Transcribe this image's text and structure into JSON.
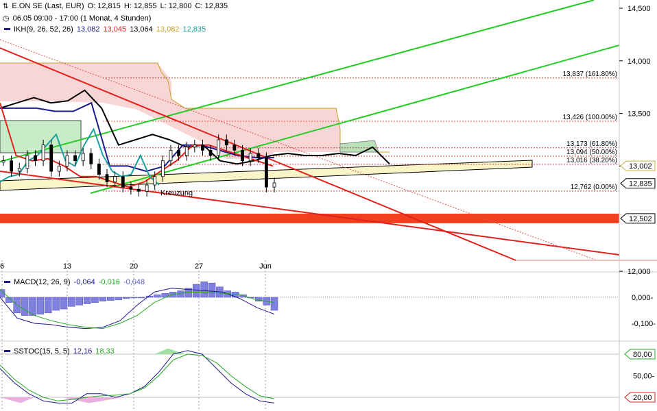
{
  "header": {
    "symbol": "E.ON SE (Last, EUR)",
    "ohlc": [
      "O: 12,815",
      "H: 12,855",
      "L: 12,800",
      "C: 12,835"
    ],
    "period": "06.05 09:00 - 17:00 (1 Monat, 4 Stunden)",
    "ikh_label": "IKH(9, 26, 52, 26)",
    "ikh_values": [
      {
        "text": "13,082",
        "color": "#1a1a8c"
      },
      {
        "text": "13,045",
        "color": "#e3211c"
      },
      {
        "text": "13,064",
        "color": "#000000"
      },
      {
        "text": "13,082",
        "color": "#c8a020"
      },
      {
        "text": "12,835",
        "color": "#1aa0a0"
      }
    ]
  },
  "chart_data": [
    {
      "type": "line",
      "panel": "price",
      "ylim": [
        12.0,
        14.5
      ],
      "y_ticks": [
        "14,500",
        "14,000",
        "13,500",
        "13,000",
        "12,000"
      ],
      "x_ticks": [
        "6",
        "13",
        "20",
        "27",
        "Jun"
      ],
      "series": [
        {
          "role": "close",
          "values": [
            13.05,
            12.95,
            12.98,
            13.1,
            13.05,
            13.2,
            12.95,
            13.0,
            13.1,
            13.05,
            13.12,
            13.02,
            12.92,
            12.85,
            12.9,
            12.8,
            12.78,
            12.76,
            12.82,
            12.9,
            13.05,
            13.15,
            13.1,
            13.18,
            13.2,
            13.15,
            13.1,
            13.25,
            13.2,
            13.15,
            13.05,
            13.12,
            13.08,
            12.8,
            12.84
          ]
        },
        {
          "role": "tenkan",
          "color": "#e3211c",
          "values": [
            13.6,
            13.1,
            13.05,
            13.07,
            13.0,
            12.9,
            12.9,
            12.85,
            12.8,
            12.85,
            12.95,
            13.05,
            13.2,
            13.2,
            13.15,
            13.1,
            13.05,
            13.0
          ]
        },
        {
          "role": "kijun",
          "color": "#1a1a8c",
          "values": [
            13.55,
            13.55,
            13.55,
            13.52,
            13.52,
            13.6,
            13.0,
            13.0,
            12.95,
            13.0,
            13.2,
            13.2,
            13.15,
            13.1,
            13.08,
            13.08
          ]
        },
        {
          "role": "chikou",
          "color": "#1aa0a0",
          "values": [
            12.85,
            12.9,
            12.92,
            13.05,
            13.1,
            13.2,
            13.3,
            13.05,
            13.0,
            13.2,
            13.35,
            13.1,
            12.95,
            12.9,
            12.92,
            13.1,
            12.9,
            12.82
          ]
        },
        {
          "role": "senkou",
          "color": "#000000",
          "values": [
            13.55,
            13.6,
            13.65,
            13.6,
            13.62,
            13.72,
            13.55,
            13.2,
            13.25,
            13.3,
            13.25,
            13.18,
            13.2,
            13.05,
            13.02,
            13.05,
            13.1,
            13.12,
            13.1,
            13.1,
            13.12,
            13.1,
            13.18,
            13.02
          ]
        }
      ],
      "fibonacci": [
        {
          "value": 13.837,
          "label": "13,837 (161.80%)"
        },
        {
          "value": 13.426,
          "label": "13,426 (100.00%)"
        },
        {
          "value": 13.173,
          "label": "13,173 (61.80%)"
        },
        {
          "value": 13.094,
          "label": "13,094 (50.00%)"
        },
        {
          "value": 13.016,
          "label": "13,016 (38.20%)"
        },
        {
          "value": 12.762,
          "label": "12,762 (0.00%)"
        }
      ],
      "price_tags": [
        {
          "value": 13.002,
          "label": "13,002",
          "color": "#c8b040"
        },
        {
          "value": 12.835,
          "label": "12,835",
          "color": "#000000"
        },
        {
          "value": 12.502,
          "label": "12,502",
          "color": "#000000"
        }
      ],
      "support_band": 12.502,
      "annotations": [
        "Kreuzung"
      ],
      "colors": {
        "cloud_bull": "#f9d6d6",
        "cloud_bear": "#b9e0b9",
        "trend_green": "#22cc22",
        "trend_red": "#e3211c",
        "band": "#faf5c8",
        "support": "#f04020"
      }
    },
    {
      "type": "bar",
      "panel": "macd",
      "title": "MACD(12, 26, 9)",
      "values_text": [
        "-0,064",
        "-0,016",
        "-0,048"
      ],
      "value_colors": [
        "#1a1a8c",
        "#22aa22",
        "#6060c0"
      ],
      "y_ticks": [
        "0,000-",
        "-0,100-"
      ],
      "ylim": [
        -0.15,
        0.1
      ],
      "histogram": [
        0.03,
        -0.02,
        -0.06,
        -0.07,
        -0.07,
        -0.065,
        -0.06,
        -0.05,
        -0.045,
        -0.035,
        -0.03,
        -0.025,
        -0.02,
        -0.015,
        -0.012,
        -0.01,
        -0.005,
        -0.002,
        0.0,
        0.005,
        0.01,
        0.015,
        0.02,
        0.025,
        0.035,
        0.05,
        0.06,
        0.055,
        0.04,
        0.025,
        0.02,
        0.01,
        0.0,
        -0.015,
        -0.03,
        -0.05
      ],
      "series": [
        {
          "role": "macd",
          "color": "#1a1a8c",
          "values": [
            0.0,
            -0.08,
            -0.1,
            -0.105,
            -0.115,
            -0.12,
            -0.115,
            -0.09,
            -0.03,
            0.02,
            0.035,
            0.03,
            0.025,
            0.02,
            -0.005,
            -0.04,
            -0.065
          ]
        },
        {
          "role": "signal",
          "color": "#22aa22",
          "values": [
            0.03,
            -0.03,
            -0.07,
            -0.09,
            -0.105,
            -0.115,
            -0.12,
            -0.1,
            -0.07,
            -0.02,
            0.01,
            0.02,
            0.02,
            0.015,
            0.01,
            -0.01,
            -0.02
          ]
        }
      ]
    },
    {
      "type": "line",
      "panel": "sstoc",
      "title": "SSTOC(15, 5, 5)",
      "values_text": [
        "12,16",
        "18,33"
      ],
      "value_colors": [
        "#1a1a8c",
        "#22aa22"
      ],
      "y_ticks": [
        "80,00",
        "50,00-",
        "20,00"
      ],
      "ylim": [
        10,
        95
      ],
      "levels": [
        80,
        20
      ],
      "series": [
        {
          "role": "k",
          "color": "#1a1a8c",
          "values": [
            60,
            40,
            25,
            15,
            12,
            12,
            25,
            25,
            20,
            25,
            35,
            55,
            80,
            85,
            80,
            60,
            40,
            25,
            15,
            12
          ]
        },
        {
          "role": "d",
          "color": "#22aa22",
          "values": [
            65,
            45,
            30,
            20,
            15,
            17,
            20,
            22,
            23,
            25,
            33,
            50,
            72,
            80,
            78,
            68,
            50,
            35,
            22,
            18
          ]
        }
      ]
    }
  ]
}
